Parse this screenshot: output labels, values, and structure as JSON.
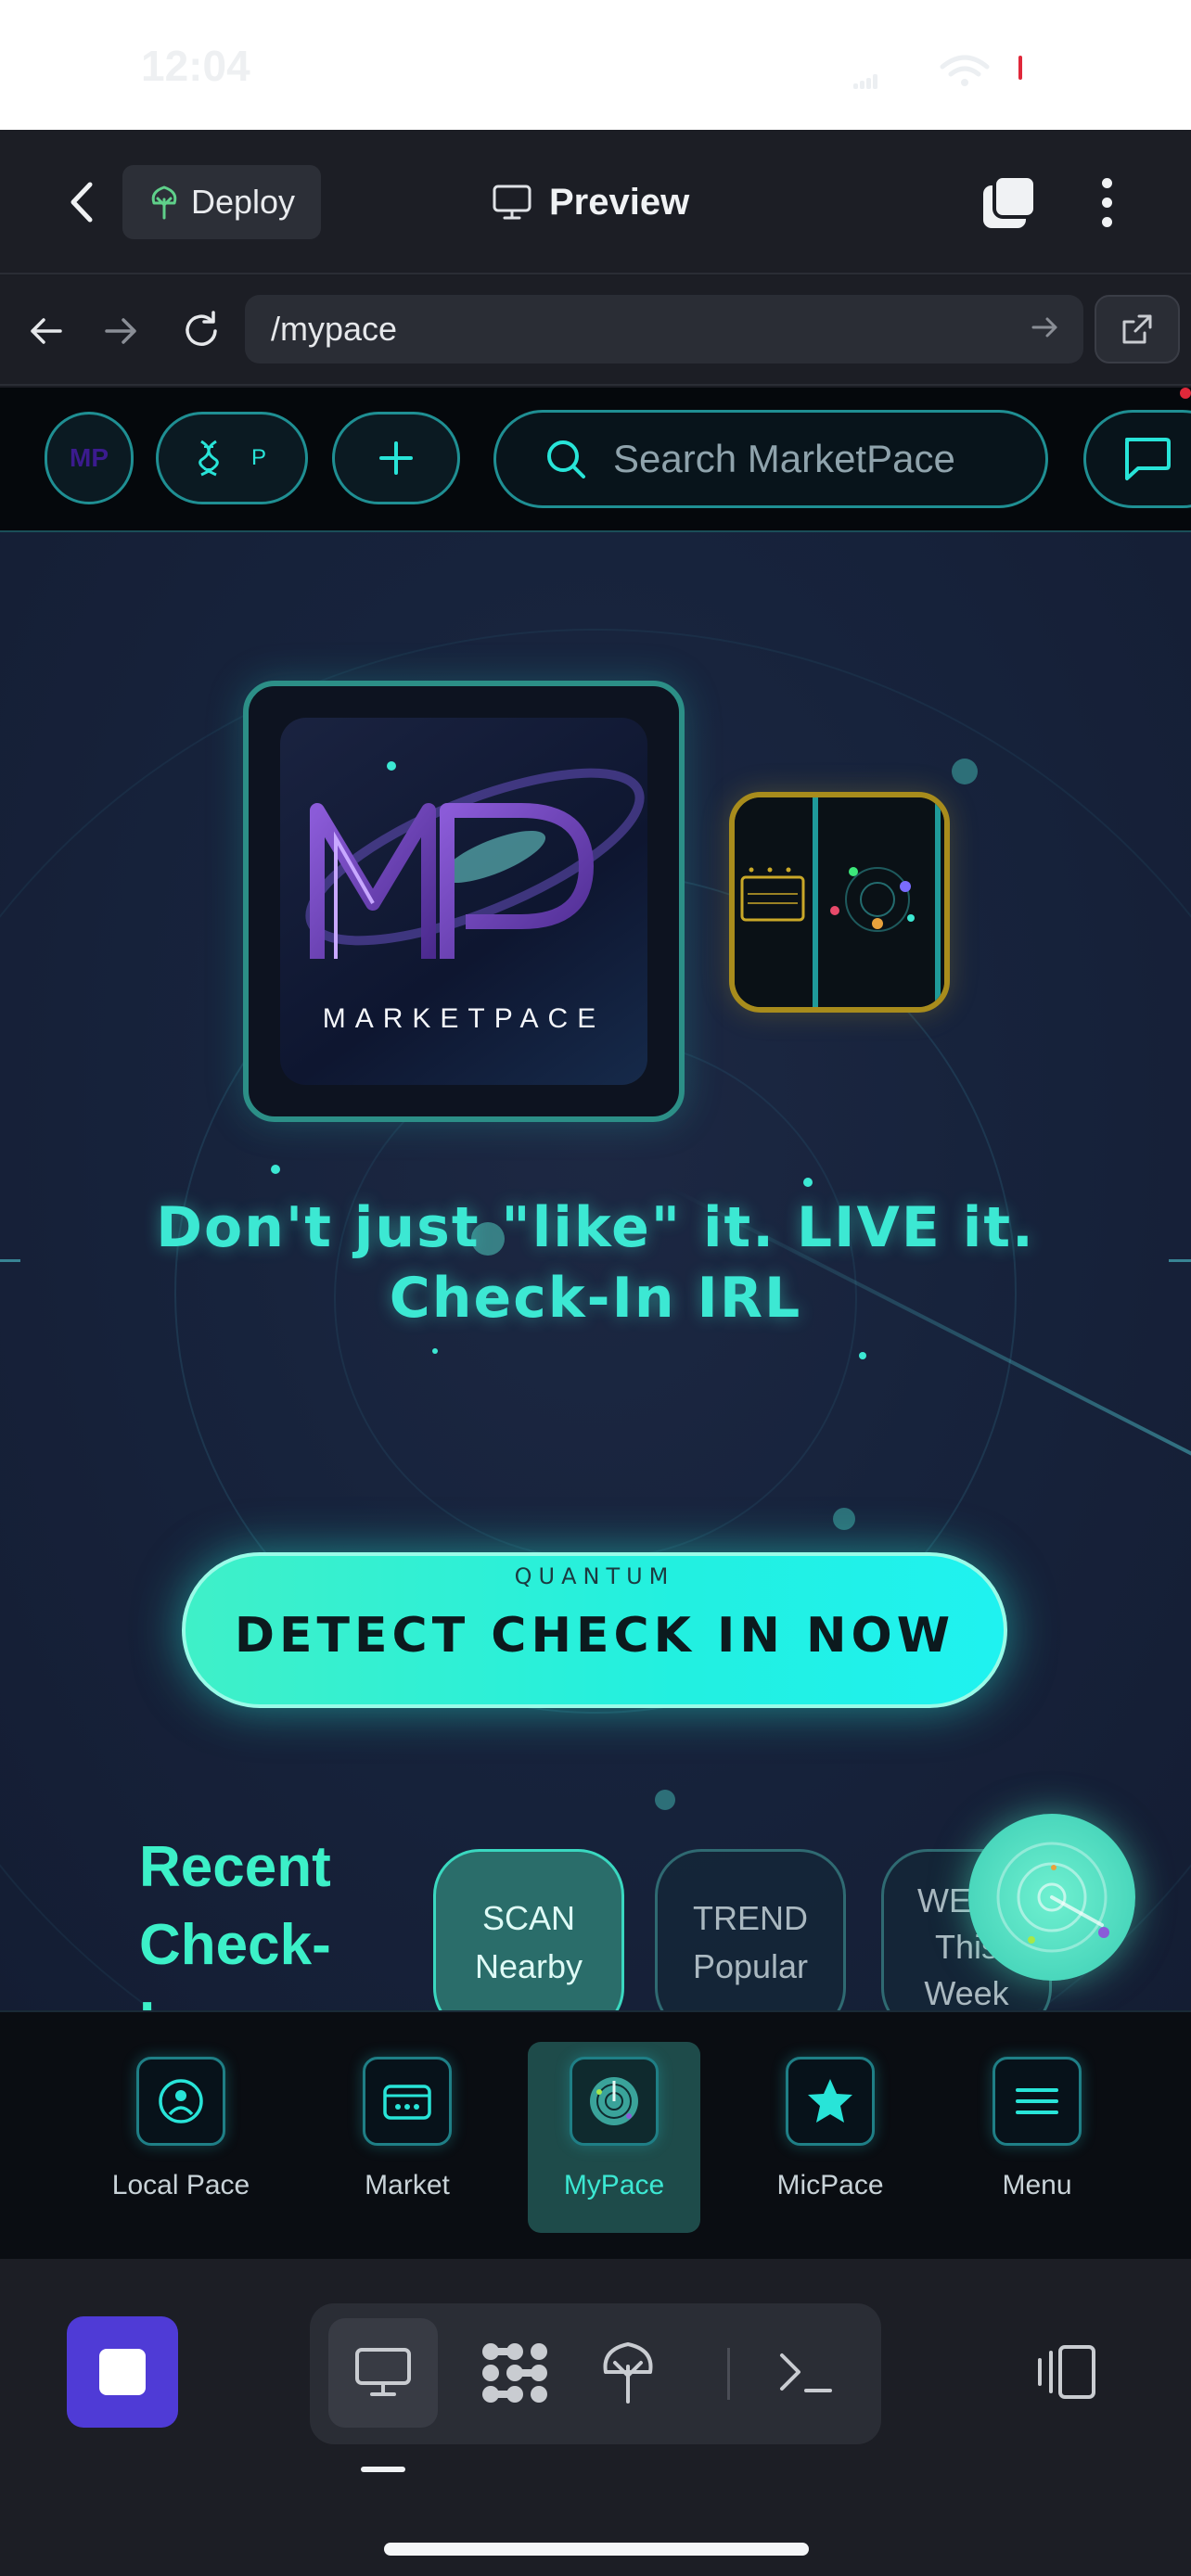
{
  "status_bar": {
    "time": "12:04"
  },
  "header": {
    "deploy_label": "Deploy",
    "title": "Preview"
  },
  "url_bar": {
    "url": "/mypace"
  },
  "site": {
    "avatar_text": "MP",
    "dna_pill_text": "P",
    "search_placeholder": "Search MarketPace",
    "logo_wordmark": "MARKETPACE",
    "logo_letters": "MP",
    "tagline": "Don't just \"like\" it. LIVE it. Check-In IRL",
    "cta_sub": "QUANTUM",
    "cta_main": "DETECT CHECK IN NOW",
    "recent_title": "Recent Check-Ins",
    "filters": [
      {
        "line1": "SCAN",
        "line2": "Nearby",
        "active": true
      },
      {
        "line1": "TREND",
        "line2": "Popular",
        "active": false
      },
      {
        "line1": "WEEK",
        "line2": "This Week",
        "active": false
      }
    ],
    "colors": {
      "accent": "#3ce8d3",
      "cta": "#22f0e0",
      "brand_purple": "#4f3bd6"
    }
  },
  "bottom_nav": [
    {
      "label": "Local Pace",
      "icon": "local-pace-icon",
      "active": false
    },
    {
      "label": "Market",
      "icon": "market-icon",
      "active": false
    },
    {
      "label": "MyPace",
      "icon": "mypace-radar-icon",
      "active": true
    },
    {
      "label": "MicPace",
      "icon": "star-icon",
      "active": false
    },
    {
      "label": "Menu",
      "icon": "menu-icon",
      "active": false
    }
  ],
  "dev_toolbar": {
    "tools": [
      "monitor-icon",
      "grid-pattern-icon",
      "deploy-tree-icon",
      "terminal-icon"
    ]
  }
}
